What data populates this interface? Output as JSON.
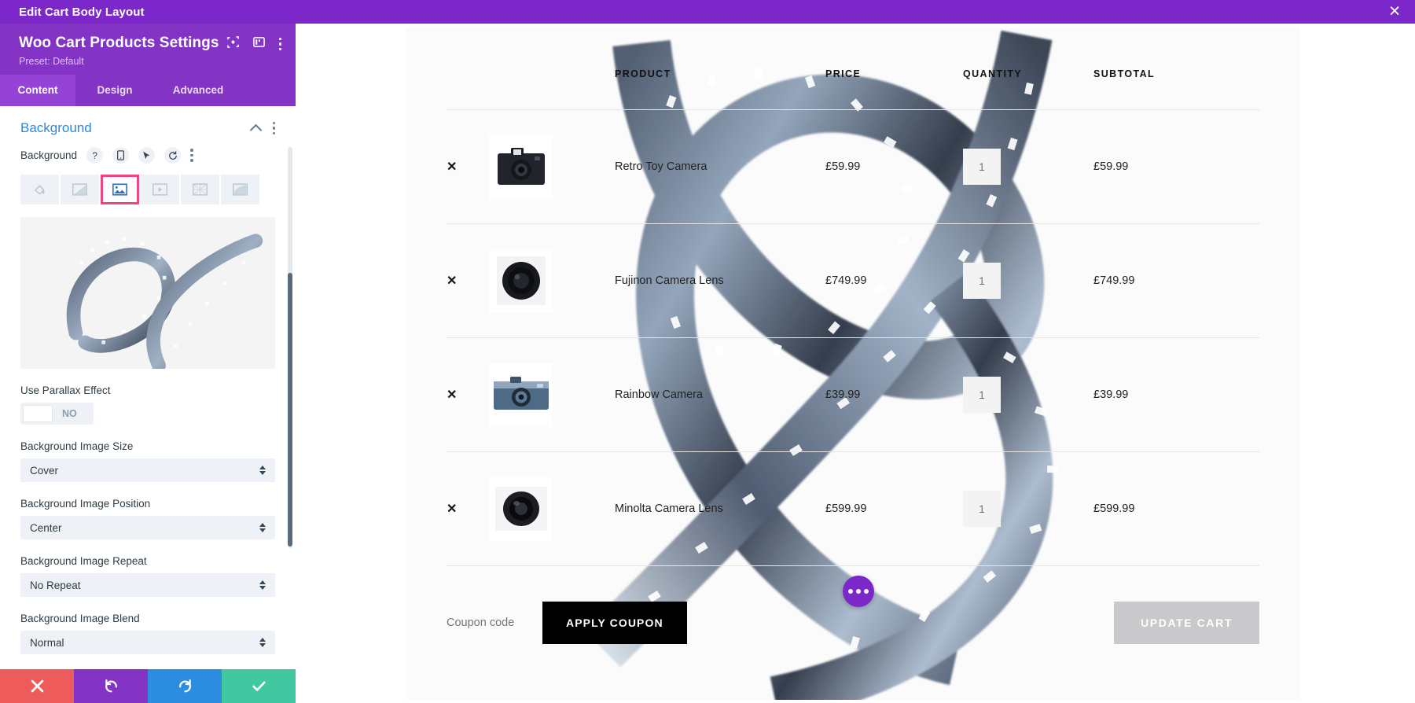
{
  "topbar": {
    "title": "Edit Cart Body Layout",
    "close_icon": "close-icon"
  },
  "panel": {
    "title": "Woo Cart Products Settings",
    "preset": "Preset: Default",
    "tabs": [
      {
        "label": "Content",
        "active": true
      },
      {
        "label": "Design",
        "active": false
      },
      {
        "label": "Advanced",
        "active": false
      }
    ],
    "section": {
      "title": "Background"
    },
    "background_field": {
      "label": "Background",
      "icons": [
        "help-icon",
        "mobile-icon",
        "cursor-icon",
        "reset-icon",
        "kebab-icon"
      ]
    },
    "background_types": [
      {
        "name": "background-color",
        "selected": false
      },
      {
        "name": "background-gradient",
        "selected": false
      },
      {
        "name": "background-image",
        "selected": true
      },
      {
        "name": "background-video",
        "selected": false
      },
      {
        "name": "background-pattern",
        "selected": false
      },
      {
        "name": "background-mask",
        "selected": false
      }
    ],
    "parallax": {
      "label": "Use Parallax Effect",
      "value": "NO"
    },
    "fields": [
      {
        "label": "Background Image Size",
        "value": "Cover"
      },
      {
        "label": "Background Image Position",
        "value": "Center"
      },
      {
        "label": "Background Image Repeat",
        "value": "No Repeat"
      },
      {
        "label": "Background Image Blend",
        "value": "Normal"
      }
    ],
    "footer_buttons": [
      {
        "name": "discard-button",
        "icon": "close-icon",
        "color": "#ed5b5b"
      },
      {
        "name": "undo-button",
        "icon": "undo-icon",
        "color": "#8334c4"
      },
      {
        "name": "redo-button",
        "icon": "redo-icon",
        "color": "#2b8ce0"
      },
      {
        "name": "save-button",
        "icon": "check-icon",
        "color": "#41c8a0"
      }
    ]
  },
  "cart": {
    "headers": [
      "PRODUCT",
      "PRICE",
      "QUANTITY",
      "SUBTOTAL"
    ],
    "rows": [
      {
        "name": "Retro Toy Camera",
        "price": "£59.99",
        "quantity": "1",
        "subtotal": "£59.99",
        "thumb": "retro-toy-camera-thumb"
      },
      {
        "name": "Fujinon Camera Lens",
        "price": "£749.99",
        "quantity": "1",
        "subtotal": "£749.99",
        "thumb": "fujinon-camera-lens-thumb"
      },
      {
        "name": "Rainbow Camera",
        "price": "£39.99",
        "quantity": "1",
        "subtotal": "£39.99",
        "thumb": "rainbow-camera-thumb"
      },
      {
        "name": "Minolta Camera Lens",
        "price": "£599.99",
        "quantity": "1",
        "subtotal": "£599.99",
        "thumb": "minolta-camera-lens-thumb"
      }
    ],
    "coupon_placeholder": "Coupon code",
    "coupon_value": "",
    "apply_coupon_label": "APPLY COUPON",
    "update_cart_label": "UPDATE CART",
    "remove_symbol": "✕"
  },
  "colors": {
    "brand_purple": "#7b27c9",
    "panel_purple": "#8334c4",
    "accent_pink": "#f0457f",
    "link_blue": "#2b87da",
    "apply_black": "#000000",
    "update_grey": "#c9c9cb"
  }
}
